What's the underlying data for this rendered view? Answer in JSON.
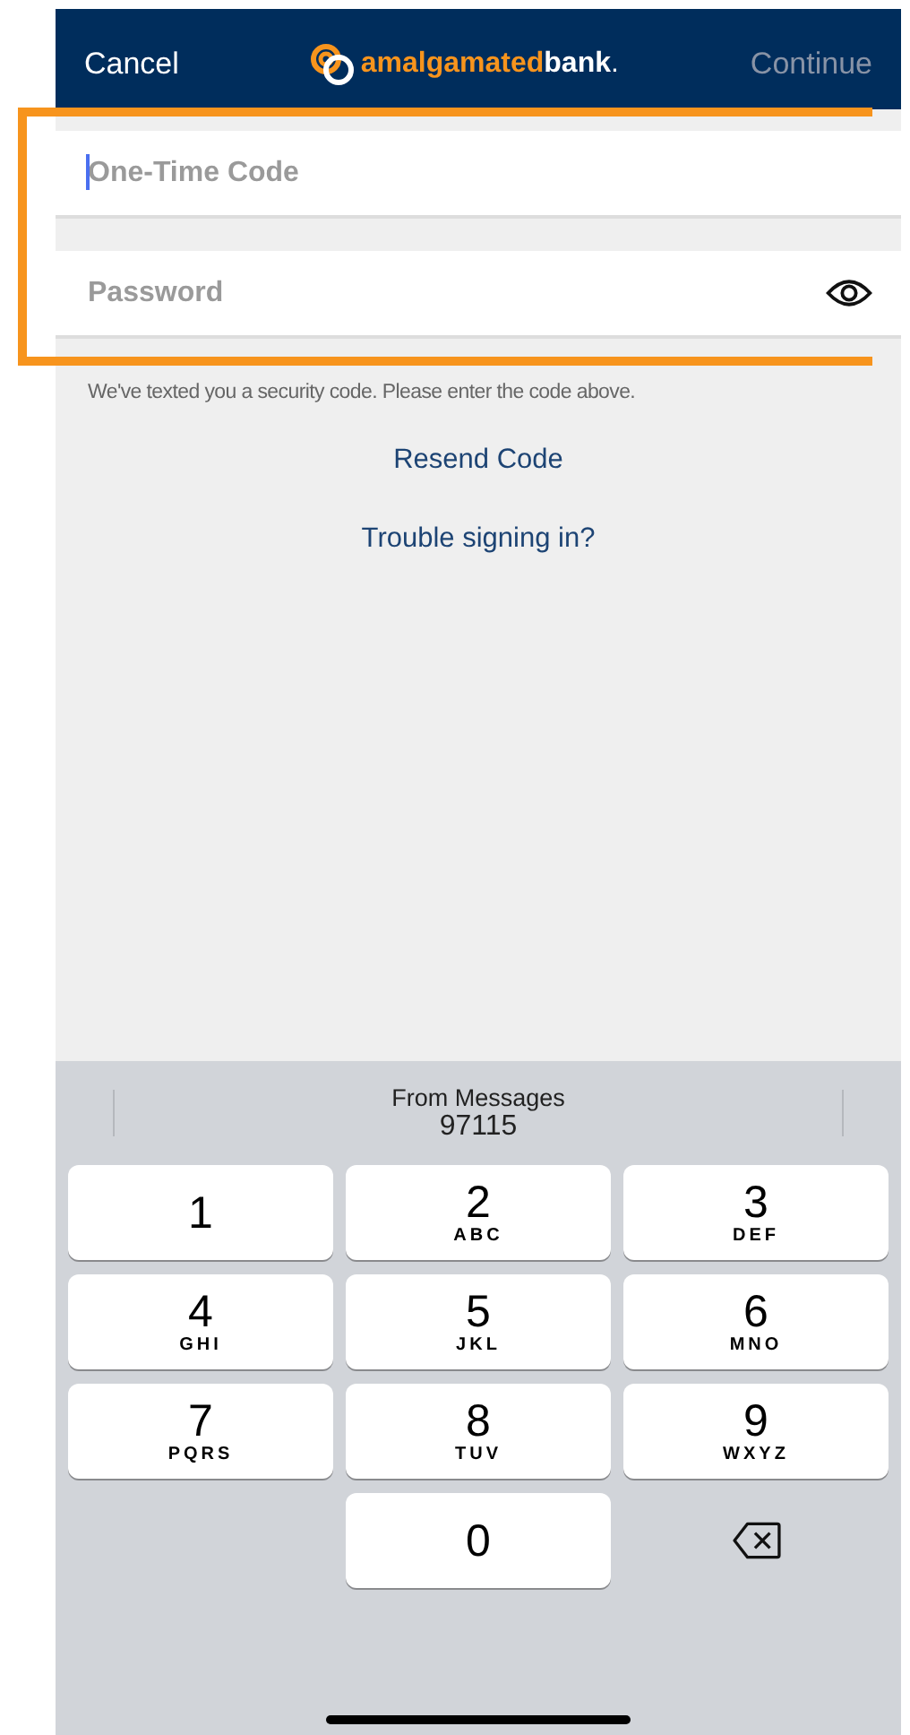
{
  "nav_bar": {
    "cancel": "Cancel",
    "logo": {
      "first": "amalgamated",
      "second": "bank",
      "dot": "."
    },
    "continue": {
      "label": "Continue",
      "disabled": true
    }
  },
  "fields": [
    {
      "placeholder": "One-Time Code",
      "focused": true,
      "kind": "code"
    },
    {
      "placeholder": "Password",
      "focused": false,
      "kind": "password"
    }
  ],
  "highlight": {
    "on": true
  },
  "message": "We've texted you a security code. Please enter the code above.",
  "links": [
    "Resend Code",
    "Trouble signing in?"
  ],
  "keyboard": {
    "suggestion": {
      "source": "From Messages",
      "code": "97115"
    },
    "keys": [
      {
        "kind": "digit",
        "digit": "1"
      },
      {
        "kind": "digit",
        "digit": "2",
        "letters": "ABC"
      },
      {
        "kind": "digit",
        "digit": "3",
        "letters": "DEF"
      },
      {
        "kind": "digit",
        "digit": "4",
        "letters": "GHI"
      },
      {
        "kind": "digit",
        "digit": "5",
        "letters": "JKL"
      },
      {
        "kind": "digit",
        "digit": "6",
        "letters": "MNO"
      },
      {
        "kind": "digit",
        "digit": "7",
        "letters": "PQRS"
      },
      {
        "kind": "digit",
        "digit": "8",
        "letters": "TUV"
      },
      {
        "kind": "digit",
        "digit": "9",
        "letters": "WXYZ"
      },
      {
        "kind": "blank"
      },
      {
        "kind": "digit",
        "digit": "0"
      },
      {
        "kind": "delete"
      }
    ]
  }
}
